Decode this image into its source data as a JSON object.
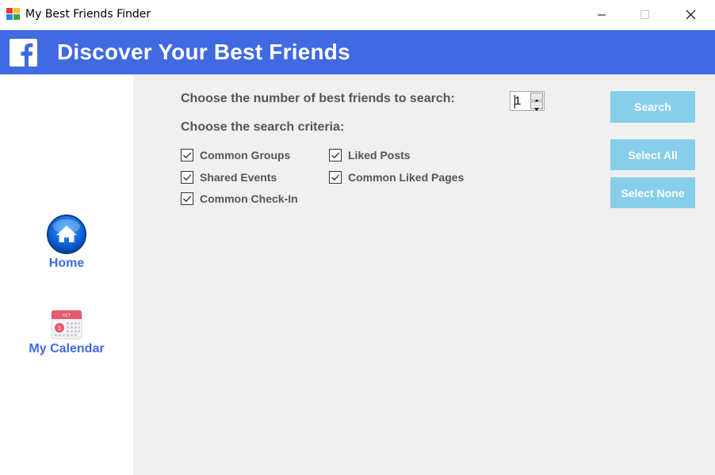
{
  "window": {
    "title": "My Best Friends Finder",
    "icon": "app-windows-icon"
  },
  "header": {
    "logo": "facebook-logo-icon",
    "title": "Discover Your Best Friends",
    "color": "#4169e1"
  },
  "sidebar": {
    "items": [
      {
        "label": "Home",
        "icon": "home-icon"
      },
      {
        "label": "My Calendar",
        "icon": "calendar-icon"
      }
    ]
  },
  "main": {
    "number_label": "Choose the number of best friends to search:",
    "number_value": "1",
    "criteria_label": "Choose the search criteria:",
    "criteria": [
      {
        "label": "Common Groups",
        "checked": true
      },
      {
        "label": "Liked Posts",
        "checked": true
      },
      {
        "label": "Shared Events",
        "checked": true
      },
      {
        "label": "Common Liked Pages",
        "checked": true
      },
      {
        "label": "Common Check-In",
        "checked": true
      }
    ],
    "buttons": {
      "search": "Search",
      "select_all": "Select All",
      "select_none": "Select None"
    },
    "button_color": "#87ceeb"
  }
}
